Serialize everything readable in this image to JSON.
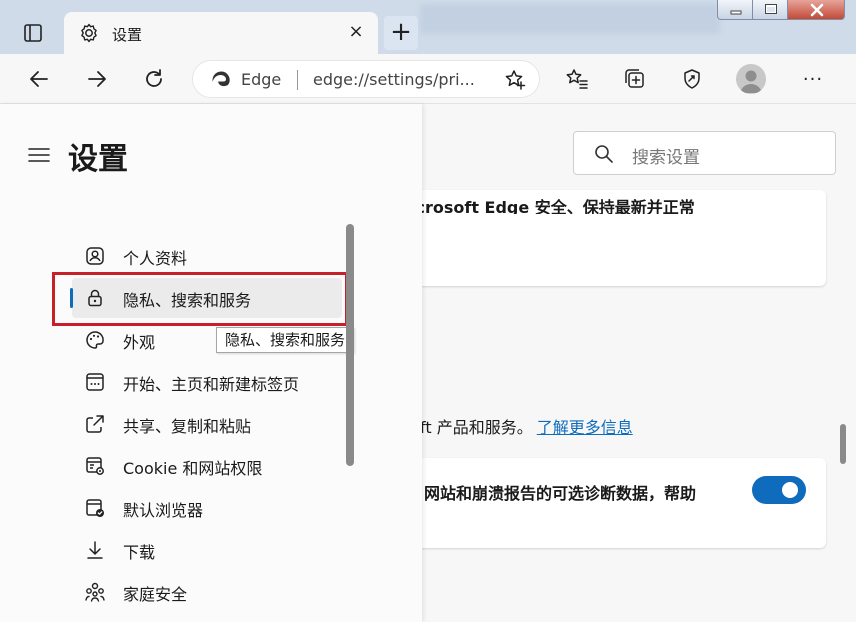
{
  "tab": {
    "title": "设置",
    "close": "×"
  },
  "new_tab": "+",
  "address": {
    "site": "Edge",
    "url": "edge://settings/pri..."
  },
  "toolbar": {
    "more": "···"
  },
  "sidebar": {
    "title": "设置",
    "items": [
      {
        "label": "个人资料",
        "icon": "profile-icon"
      },
      {
        "label": "隐私、搜索和服务",
        "icon": "lock-icon",
        "selected": true
      },
      {
        "label": "外观",
        "icon": "palette-icon"
      },
      {
        "label": "开始、主页和新建标签页",
        "icon": "start-page-icon"
      },
      {
        "label": "共享、复制和粘贴",
        "icon": "share-icon"
      },
      {
        "label": "Cookie 和网站权限",
        "icon": "site-permissions-icon"
      },
      {
        "label": "默认浏览器",
        "icon": "default-browser-icon"
      },
      {
        "label": "下载",
        "icon": "download-icon"
      },
      {
        "label": "家庭安全",
        "icon": "family-icon"
      }
    ]
  },
  "tooltip": "隐私、搜索和服务",
  "search": {
    "placeholder": "搜索设置"
  },
  "content": {
    "card1_text": "icrosoft Edge 安全、保持最新并正常",
    "info_text": "ft 产品和服务。",
    "learn_more": "了解更多信息",
    "card2_text": "网站和崩溃报告的可选诊断数据，帮助",
    "toggle_on": true
  },
  "colors": {
    "accent": "#0f6cbd",
    "highlight_border": "#c8202a"
  }
}
